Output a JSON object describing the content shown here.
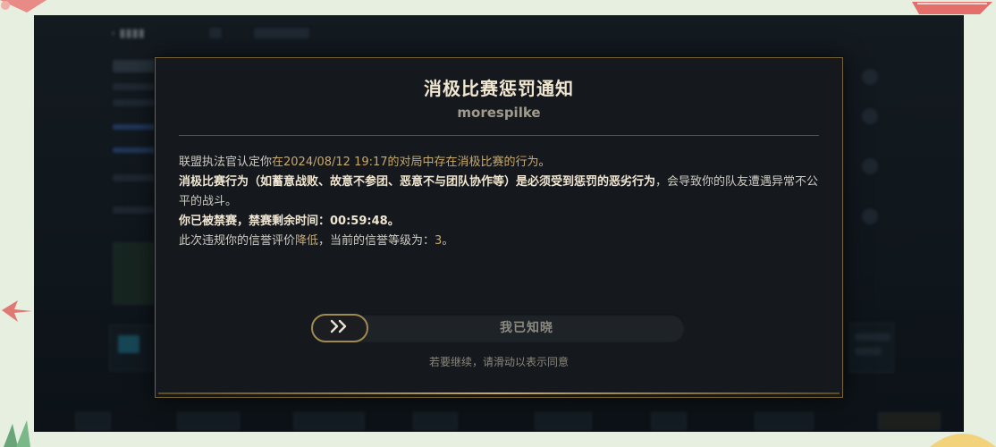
{
  "dialog": {
    "title": "消极比赛惩罚通知",
    "summoner_name": "morespilke",
    "line1": {
      "prefix": "联盟执法官认定你",
      "highlight": "在2024/08/12 19:17的对局中存在消极比赛的行为",
      "suffix": "。"
    },
    "line2": {
      "bold": "消极比赛行为（如蓄意战败、故意不参团、恶意不与团队协作等）是必须受到惩罚的恶劣行为",
      "rest": "，会导致你的队友遭遇异常不公平的战斗。"
    },
    "line3": {
      "label": "你已被禁赛，禁赛剩余时间：",
      "time": "00:59:48",
      "end": "。"
    },
    "line4": {
      "prefix": "此次违规你的信誉评价",
      "change": "降低",
      "middle": "，当前的信誉等级为：",
      "level": "3",
      "end": "。"
    }
  },
  "slider": {
    "knob_icon": "double-chevron-right-icon",
    "label": "我已知晓",
    "hint": "若要继续，请滑动以表示同意"
  },
  "colors": {
    "accent_gold": "#c8aa6e",
    "frame_gold": "#7a6534",
    "dialog_bg": "#15181c",
    "title_text": "#f0e6d2"
  }
}
